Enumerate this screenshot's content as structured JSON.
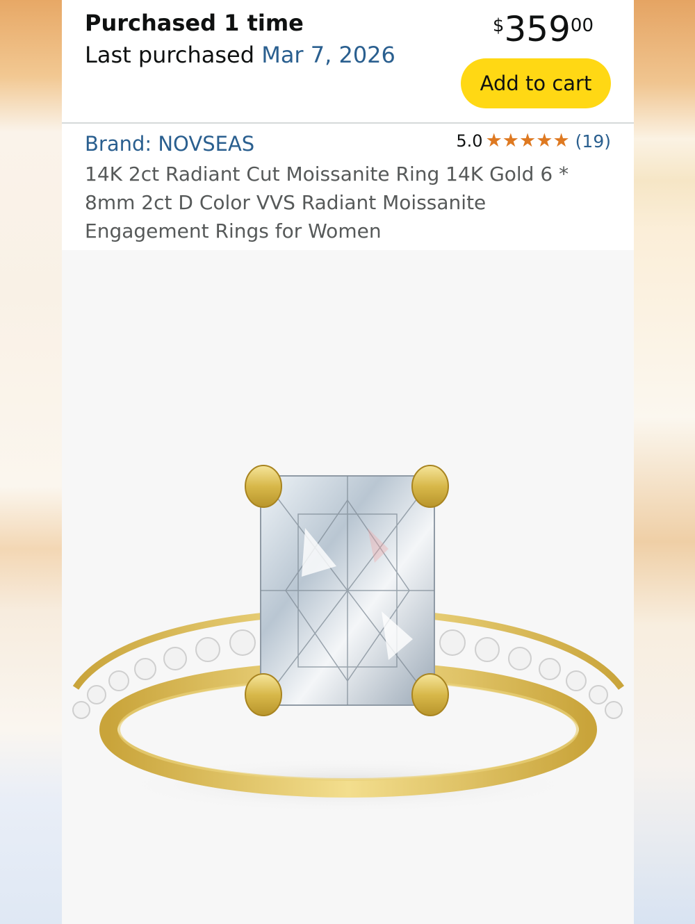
{
  "purchase": {
    "times_label": "Purchased 1 time",
    "last_label": "Last purchased ",
    "last_date": "Mar 7, 2026"
  },
  "price": {
    "symbol": "$",
    "whole": "359",
    "fraction": "00"
  },
  "cart": {
    "label": "Add to cart"
  },
  "product": {
    "brand": "Brand: NOVSEAS",
    "rating": "5.0",
    "stars": 5,
    "review_count": "(19)",
    "title": "14K 2ct Radiant Cut Moissanite Ring 14K Gold 6 * 8mm 2ct D Color VVS Radiant Moissanite Engagement Rings for Women"
  },
  "colors": {
    "accent_link": "#2a5f8f",
    "cart_button": "#ffd814",
    "star": "#de7921"
  },
  "icons": [
    "star-icon"
  ]
}
